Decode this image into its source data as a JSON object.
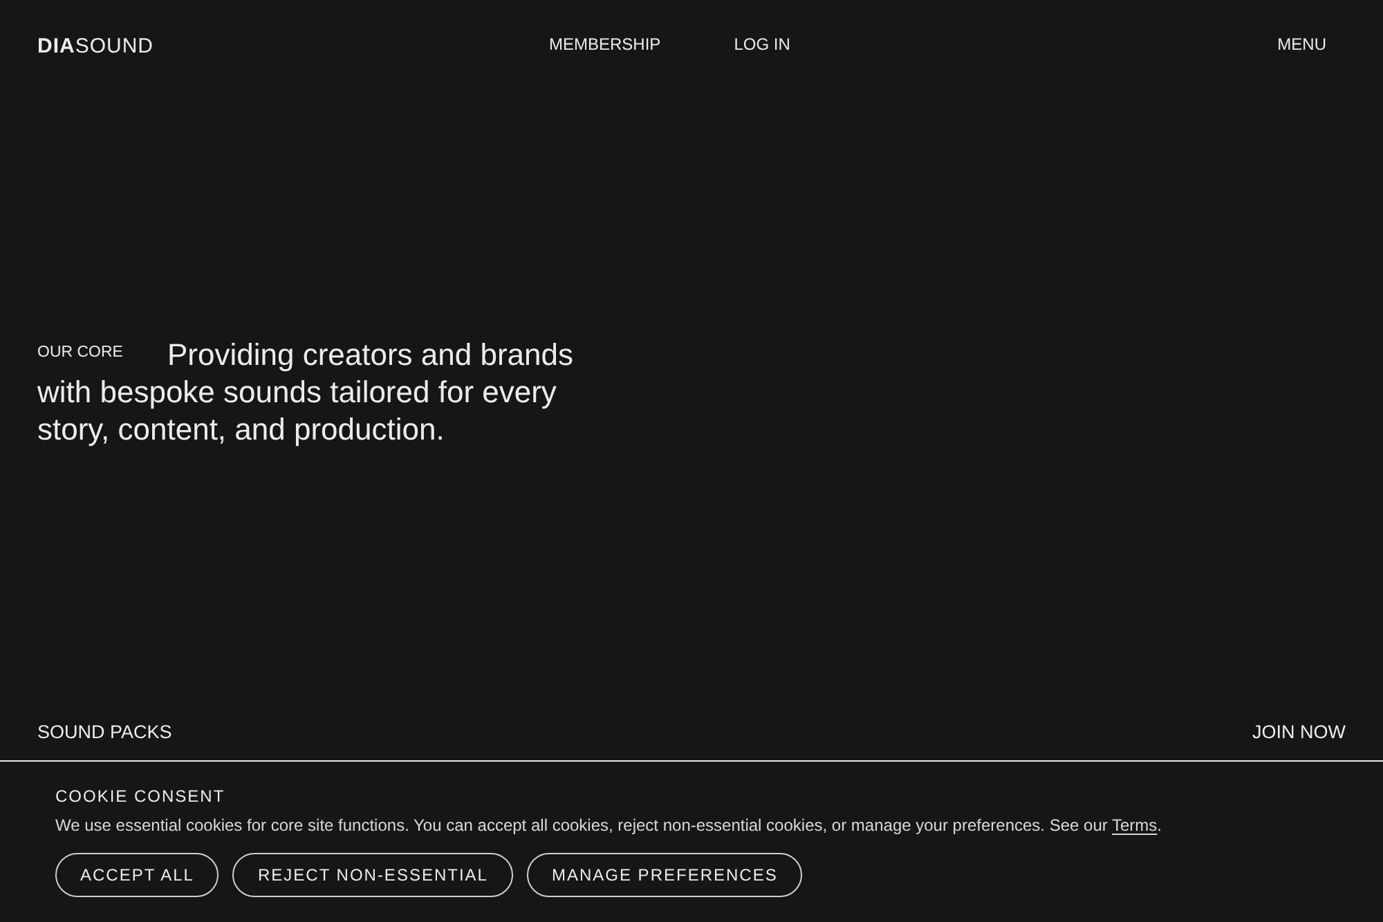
{
  "header": {
    "logo": {
      "strong": "DIA",
      "light": "SOUND"
    },
    "nav": [
      "MEMBERSHIP",
      "LOG IN"
    ],
    "menu": "MENU"
  },
  "hero": {
    "label": "OUR CORE",
    "lines": [
      "Providing creators and brands",
      "with bespoke sounds tailored for every",
      "story, content, and production."
    ]
  },
  "bottom_bar": {
    "left": "SOUND PACKS",
    "right": "JOIN NOW"
  },
  "cookie_banner": {
    "title": "COOKIE CONSENT",
    "text": "We use essential cookies for core site functions. You can accept all cookies, reject non-essential cookies, or manage your preferences. See our",
    "link": "Terms",
    "after": ".",
    "buttons": [
      "ACCEPT ALL",
      "REJECT NON-ESSENTIAL",
      "MANAGE PREFERENCES"
    ]
  }
}
